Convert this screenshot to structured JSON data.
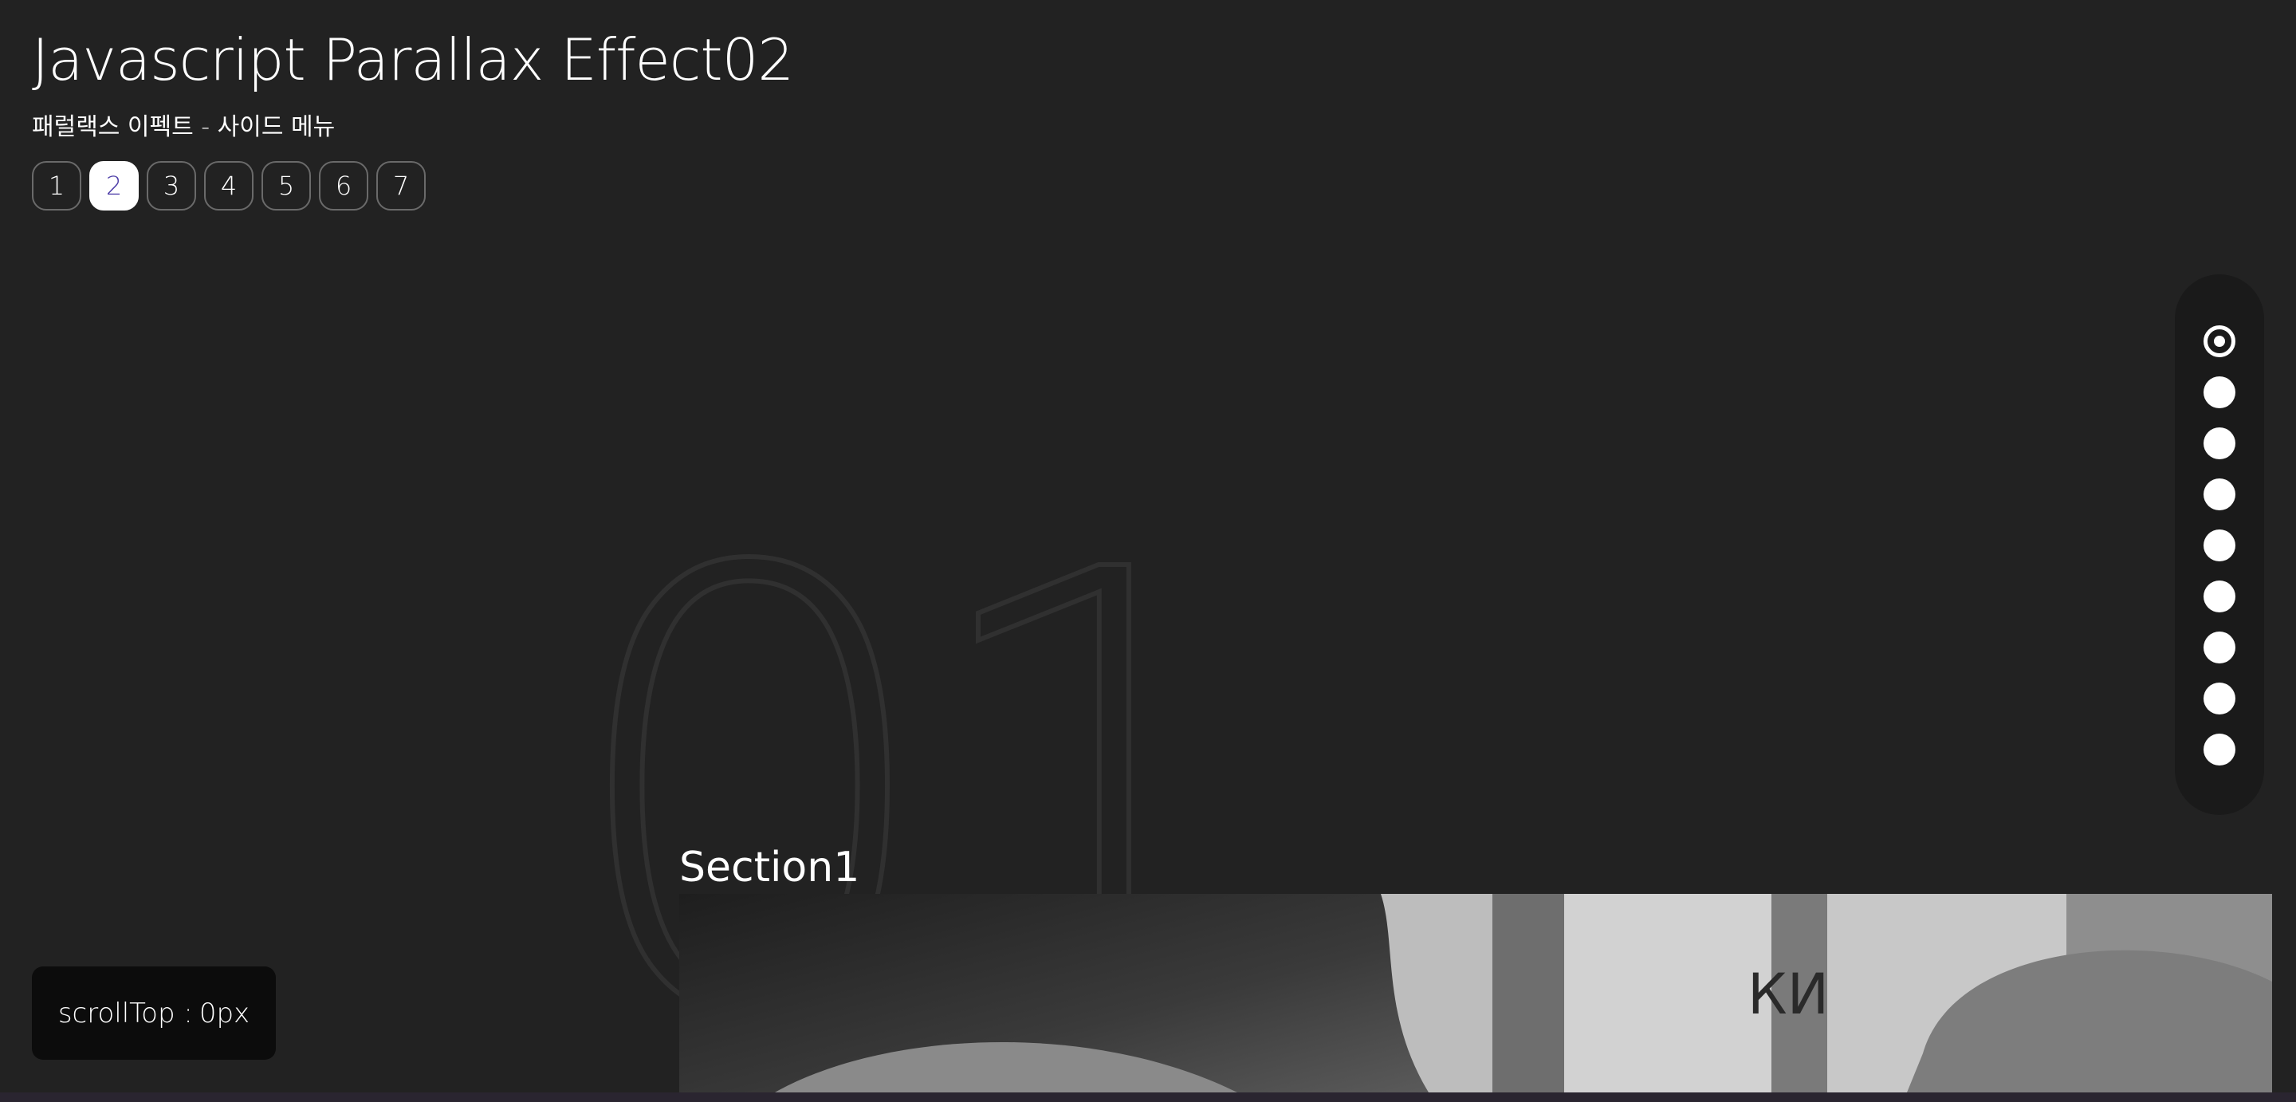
{
  "header": {
    "title": "Javascript Parallax Effect02",
    "subtitle": "패럴랙스 이펙트 - 사이드 메뉴",
    "pages": [
      "1",
      "2",
      "3",
      "4",
      "5",
      "6",
      "7"
    ],
    "active_page": "2"
  },
  "side_nav": {
    "dot_count": 9,
    "active_index": 0
  },
  "section": {
    "number": "01",
    "title": "Section1",
    "image_alt": "black and white photo"
  },
  "scroll_info": {
    "label": "scrollTop :",
    "value": "0px"
  },
  "colors": {
    "background": "#222222",
    "dots_panel": "#1a1a1a",
    "scroll_box": "#0c0c0c",
    "active_page_text": "#4a3aa6"
  }
}
